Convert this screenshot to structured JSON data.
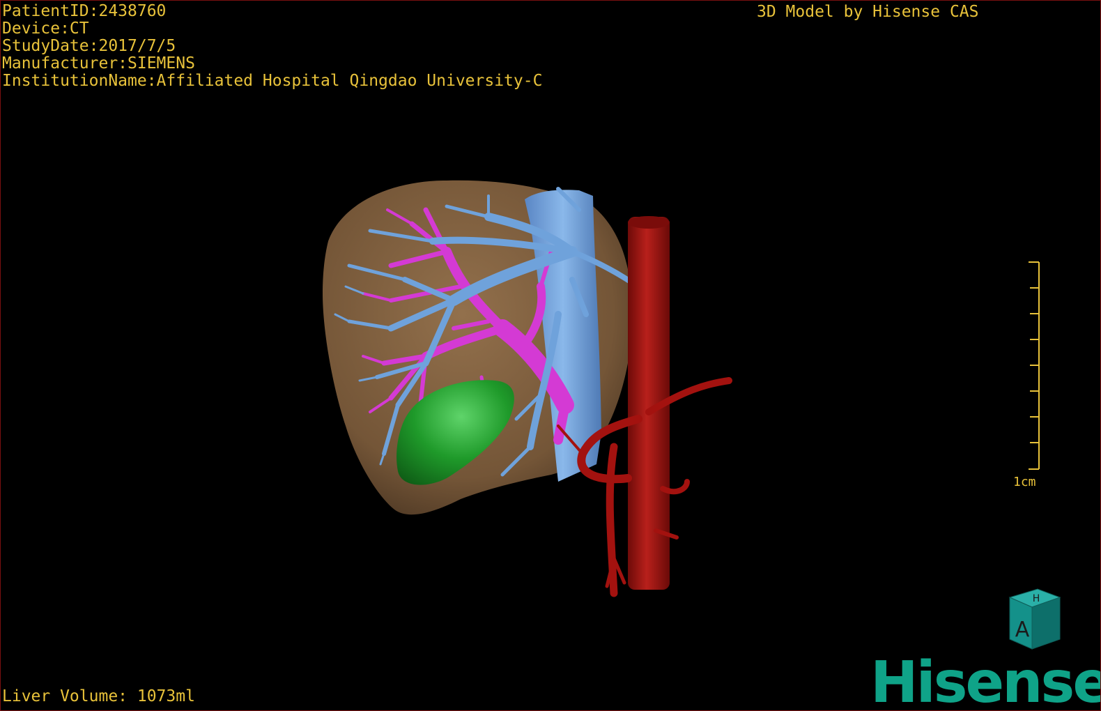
{
  "patient_info": {
    "patient_id": "PatientID:2438760",
    "device": "Device:CT",
    "study_date": "StudyDate:2017/7/5",
    "manufacturer": "Manufacturer:SIEMENS",
    "institution": "InstitutionName:Affiliated Hospital Qingdao University-C"
  },
  "model_credit": "3D Model by Hisense CAS",
  "liver_volume": "Liver Volume: 1073ml",
  "scale_bar": {
    "label": "1cm"
  },
  "orientation_cube": {
    "front_label": "A",
    "top_label": "H"
  },
  "brand_logo": "Hisense",
  "colors": {
    "overlay_text": "#e8c23a",
    "liver": "#8c6a45",
    "hepatic_vein": "#6fa2db",
    "portal_vein": "#d43ad4",
    "gallbladder": "#1f9a2a",
    "aorta": "#a3120f",
    "brand": "#0fa388"
  },
  "icons": [
    "orientation-cube-icon",
    "hisense-logo"
  ]
}
